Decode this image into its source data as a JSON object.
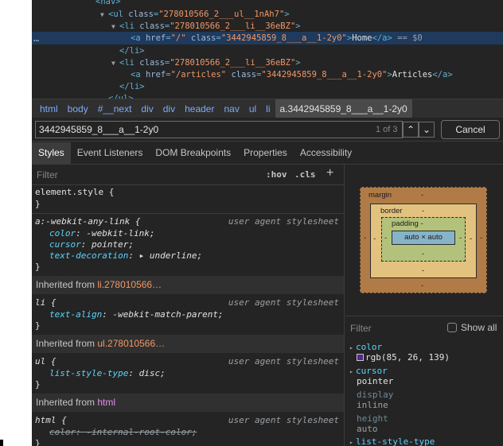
{
  "dom_tree": {
    "lines": [
      {
        "indent": 0,
        "arrow": "",
        "parts": [
          [
            "tag",
            "<nav>"
          ]
        ]
      },
      {
        "indent": 1,
        "arrow": "▼",
        "parts": [
          [
            "tag",
            "<ul "
          ],
          [
            "an",
            "class"
          ],
          [
            "tag",
            "="
          ],
          [
            "av",
            "\"278010566_2___ul__1nAh7\""
          ],
          [
            "tag",
            ">"
          ]
        ]
      },
      {
        "indent": 2,
        "arrow": "▼",
        "parts": [
          [
            "tag",
            "<li "
          ],
          [
            "an",
            "class"
          ],
          [
            "tag",
            "="
          ],
          [
            "av",
            "\"278010566_2___li__36eBZ\""
          ],
          [
            "tag",
            ">"
          ]
        ]
      },
      {
        "indent": 3,
        "arrow": "",
        "parts": [
          [
            "tag",
            "<a "
          ],
          [
            "an",
            "href"
          ],
          [
            "tag",
            "="
          ],
          [
            "av",
            "\"/\""
          ],
          [
            "tag",
            " "
          ],
          [
            "an",
            "class"
          ],
          [
            "tag",
            "="
          ],
          [
            "av",
            "\"3442945859_8___a__1-2y0\""
          ],
          [
            "tag",
            ">"
          ],
          [
            "tx",
            "Home"
          ],
          [
            "tag",
            "</a>"
          ],
          [
            "dim",
            " == $0"
          ]
        ],
        "selected": true
      },
      {
        "indent": 2,
        "arrow": "",
        "parts": [
          [
            "tag",
            "</li>"
          ]
        ]
      },
      {
        "indent": 2,
        "arrow": "▼",
        "parts": [
          [
            "tag",
            "<li "
          ],
          [
            "an",
            "class"
          ],
          [
            "tag",
            "="
          ],
          [
            "av",
            "\"278010566_2___li__36eBZ\""
          ],
          [
            "tag",
            ">"
          ]
        ]
      },
      {
        "indent": 3,
        "arrow": "",
        "parts": [
          [
            "tag",
            "<a "
          ],
          [
            "an",
            "href"
          ],
          [
            "tag",
            "="
          ],
          [
            "av",
            "\"/articles\""
          ],
          [
            "tag",
            " "
          ],
          [
            "an",
            "class"
          ],
          [
            "tag",
            "="
          ],
          [
            "av",
            "\"3442945859_8___a__1-2y0\""
          ],
          [
            "tag",
            ">"
          ],
          [
            "tx",
            "Articles"
          ],
          [
            "tag",
            "</a>"
          ]
        ]
      },
      {
        "indent": 2,
        "arrow": "",
        "parts": [
          [
            "tag",
            "</li>"
          ]
        ]
      },
      {
        "indent": 2,
        "arrow": "",
        "parts": [
          [
            "tag",
            "</ul>"
          ]
        ]
      }
    ],
    "ellipsis": "…"
  },
  "breadcrumb": [
    "html",
    "body",
    "#__next",
    "div",
    "div",
    "header",
    "nav",
    "ul",
    "li",
    "a.3442945859_8___a__1-2y0"
  ],
  "search": {
    "value": "3442945859_8___a__1-2y0",
    "match_count": "1 of 3",
    "up": "⌃",
    "down": "⌄",
    "cancel": "Cancel"
  },
  "tabs": [
    "Styles",
    "Event Listeners",
    "DOM Breakpoints",
    "Properties",
    "Accessibility"
  ],
  "styles": {
    "filter_placeholder": "Filter",
    "hov": ":hov",
    "cls": ".cls",
    "plus": "+",
    "element_style": "element.style {",
    "close": "}",
    "rule1": {
      "selector": "a:-webkit-any-link {",
      "source": "user agent stylesheet",
      "props": [
        {
          "name": "color",
          "value": "-webkit-link;"
        },
        {
          "name": "cursor",
          "value": "pointer;"
        },
        {
          "name": "text-decoration",
          "value": "▸ underline;"
        }
      ]
    },
    "inherited1": {
      "label": "Inherited from ",
      "selector": "li.278010566…"
    },
    "rule2": {
      "selector": "li {",
      "source": "user agent stylesheet",
      "props": [
        {
          "name": "text-align",
          "value": "-webkit-match-parent;"
        }
      ]
    },
    "inherited2": {
      "label": "Inherited from ",
      "selector": "ul.278010566…"
    },
    "rule3": {
      "selector": "ul {",
      "source": "user agent stylesheet",
      "props": [
        {
          "name": "list-style-type",
          "value": "disc;"
        }
      ]
    },
    "inherited3": {
      "label": "Inherited from ",
      "selector": "html"
    },
    "rule4": {
      "selector": "html {",
      "source": "user agent stylesheet",
      "props": [
        {
          "name": "color",
          "value": "-internal-root-color;"
        }
      ]
    }
  },
  "box_model": {
    "margin": "margin",
    "border": "border",
    "padding": "padding -",
    "content": "auto × auto",
    "dash": "-"
  },
  "computed": {
    "filter_placeholder": "Filter",
    "show_all": "Show all",
    "items": [
      {
        "name": "color",
        "value": "rgb(85, 26, 139)",
        "arrow": "▸",
        "swatch": "#55268b"
      },
      {
        "name": "cursor",
        "value": "pointer",
        "arrow": "▸"
      },
      {
        "name": "display",
        "value": "inline",
        "inherited": true
      },
      {
        "name": "height",
        "value": "auto",
        "inherited": true
      },
      {
        "name": "list-style-type",
        "value": "",
        "arrow": "▸"
      }
    ]
  }
}
